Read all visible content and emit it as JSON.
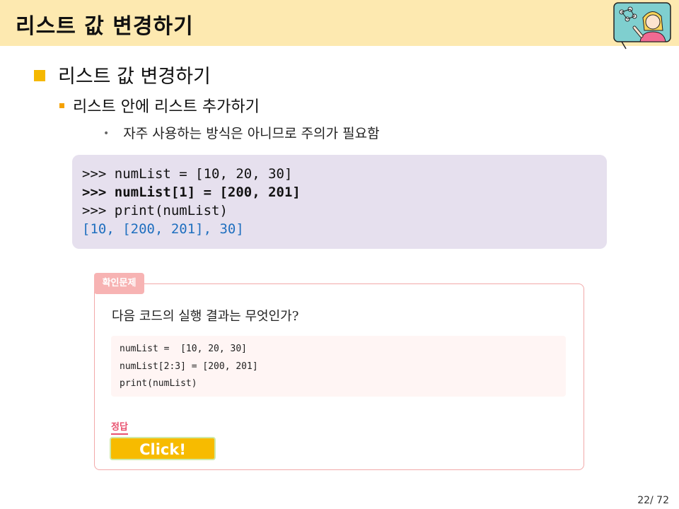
{
  "slide": {
    "title": "리스트 값 변경하기",
    "heading1": "리스트 값 변경하기",
    "heading2": "리스트 안에 리스트 추가하기",
    "bullet3": "자주 사용하는 방식은 아니므로 주의가 필요함",
    "bullet3_marker": "•"
  },
  "code": {
    "line1": ">>> numList = [10, 20, 30]",
    "line2": ">>> numList[1] = [200, 201]",
    "line3": ">>> print(numList)",
    "line4": "[10, [200, 201], 30]"
  },
  "quiz": {
    "tab_label": "확인문제",
    "question": "다음 코드의 실행 결과는 무엇인가?",
    "code_line1": "numList =  [10, 20, 30]",
    "code_line2": "numList[2:3] = [200, 201]",
    "code_line3": "print(numList)",
    "answer_label": "정답",
    "button_label": "Click!"
  },
  "page": {
    "number": "22/ 72"
  },
  "colors": {
    "title_bar": "#fde9b0",
    "bullet_accent": "#f5b800",
    "code_bg": "#e6e0ee",
    "output_text": "#1f6fbf",
    "quiz_border": "#f2a9a9",
    "answer_accent": "#e8516e",
    "button_bg": "#f7bb00"
  },
  "icons": {
    "avatar": "teacher-illustration-icon"
  }
}
